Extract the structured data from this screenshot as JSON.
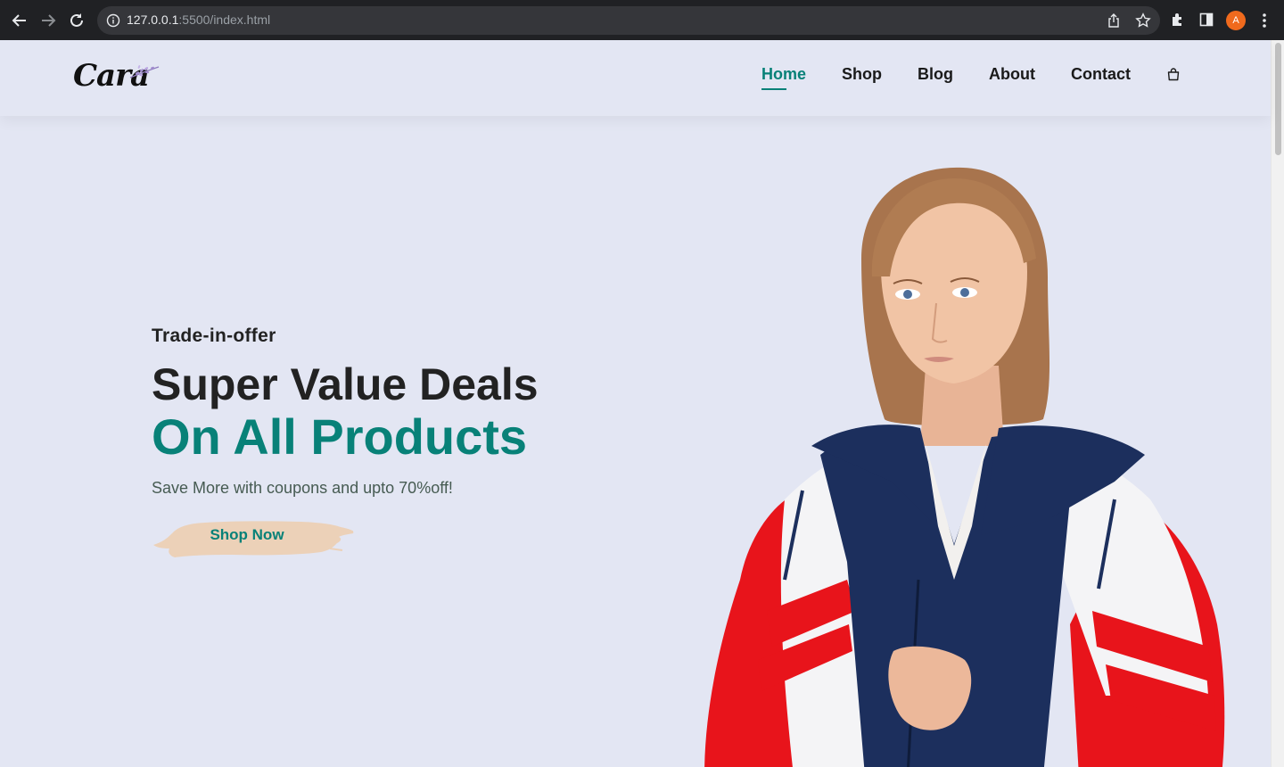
{
  "browser": {
    "url_host": "127.0.0.1",
    "url_path": ":5500/index.html",
    "profile_initial": "A",
    "accent": "#f06a1d"
  },
  "site": {
    "logo_text": "Cara",
    "nav": [
      {
        "label": "Home",
        "active": true
      },
      {
        "label": "Shop",
        "active": false
      },
      {
        "label": "Blog",
        "active": false
      },
      {
        "label": "About",
        "active": false
      },
      {
        "label": "Contact",
        "active": false
      }
    ],
    "cart_icon": "shopping-bag-icon"
  },
  "hero": {
    "kicker": "Trade-in-offer",
    "headline_line1": "Super Value Deals",
    "headline_line2": "On All Products",
    "subtext": "Save More with coupons and upto 70%off!",
    "cta_label": "Shop Now",
    "image": "model-in-track-jacket"
  },
  "colors": {
    "brand": "#088178",
    "background": "#e3e6f3",
    "cta_brush": "#ecd1b8"
  }
}
